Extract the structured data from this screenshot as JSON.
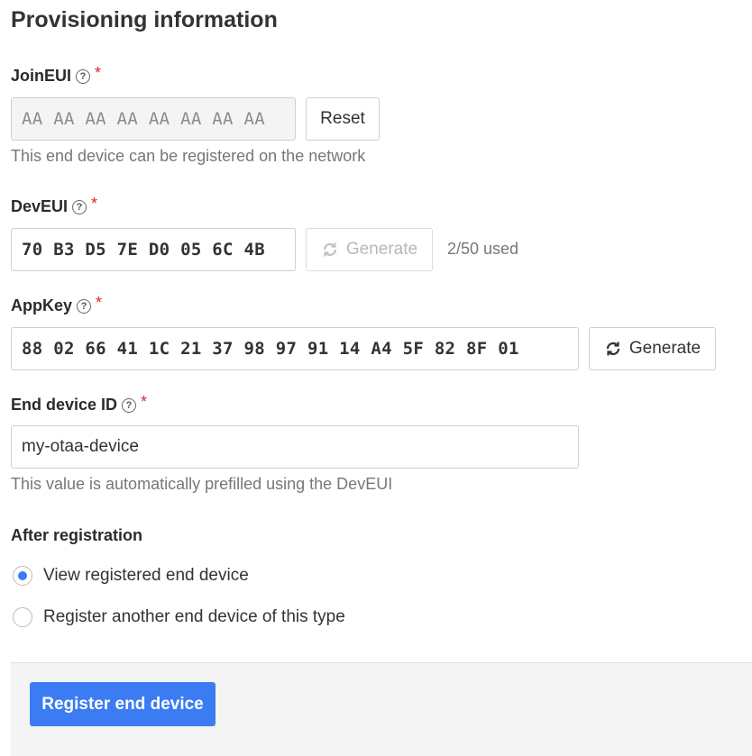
{
  "page_title": "Provisioning information",
  "join_eui": {
    "label": "JoinEUI",
    "placeholder": "AA AA AA AA AA AA AA AA",
    "reset_label": "Reset",
    "hint": "This end device can be registered on the network"
  },
  "dev_eui": {
    "label": "DevEUI",
    "value": "70 B3 D5 7E D0 05 6C 4B",
    "generate_label": "Generate",
    "usage": "2/50 used"
  },
  "app_key": {
    "label": "AppKey",
    "value": "88 02 66 41 1C 21 37 98 97 91 14 A4 5F 82 8F 01",
    "generate_label": "Generate"
  },
  "end_device_id": {
    "label": "End device ID",
    "value": "my-otaa-device",
    "hint": "This value is automatically prefilled using the DevEUI"
  },
  "after_registration": {
    "label": "After registration",
    "options": [
      {
        "label": "View registered end device",
        "selected": true
      },
      {
        "label": "Register another end device of this type",
        "selected": false
      }
    ]
  },
  "help_glyph": "?",
  "required_marker": "*",
  "submit_label": "Register end device",
  "colors": {
    "accent": "#3b7cf3",
    "required": "#db2828"
  }
}
